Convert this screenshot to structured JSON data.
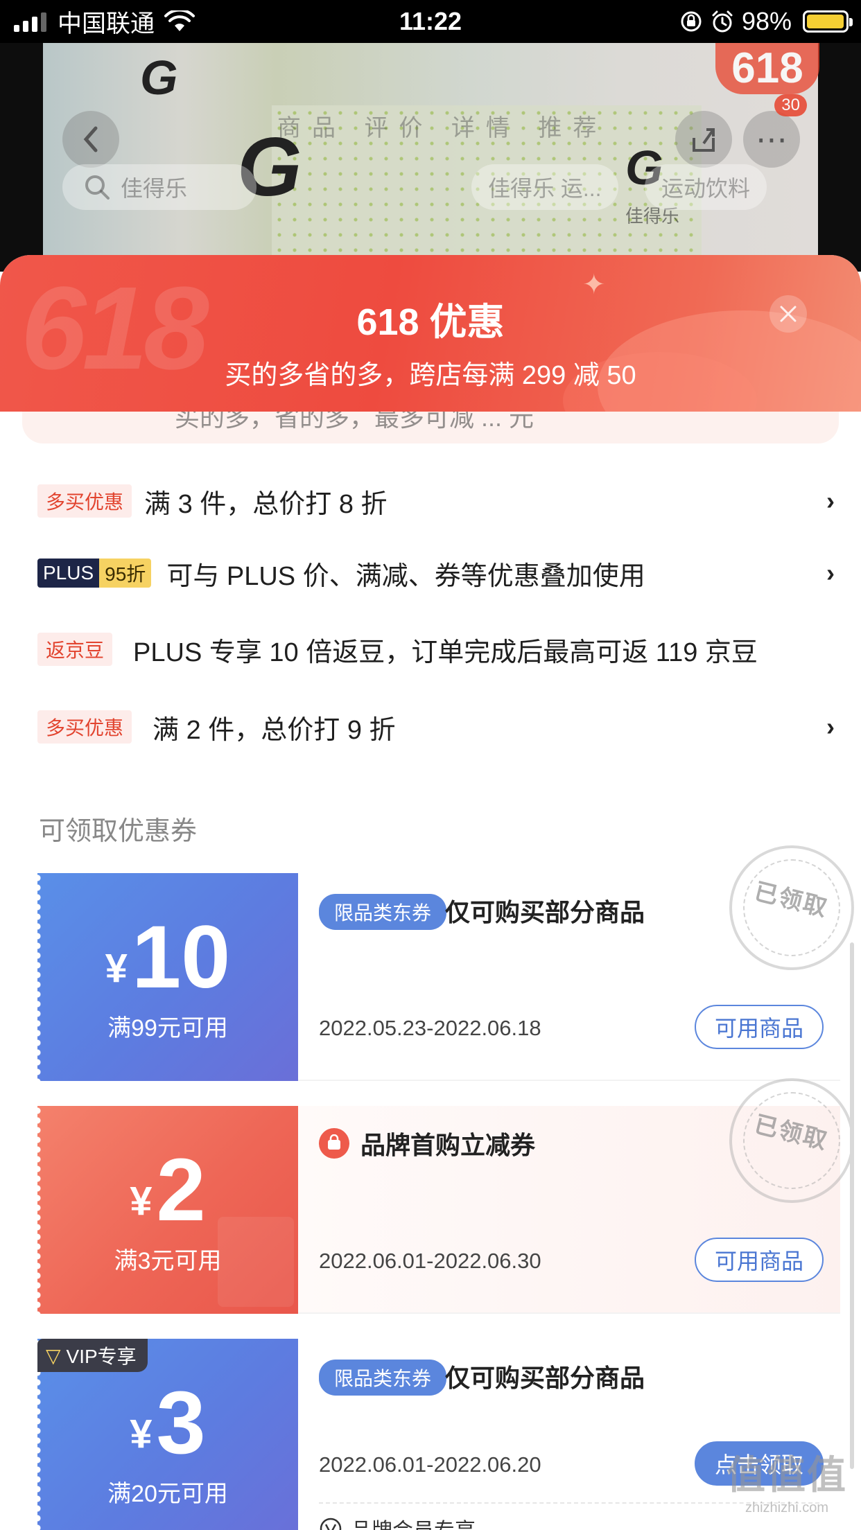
{
  "status_bar": {
    "carrier": "中国联通",
    "time": "11:22",
    "battery_percent": "98%",
    "battery_level": 0.98
  },
  "background_page": {
    "badge": "618",
    "tabs": "商品 评价 详情 推荐",
    "search_placeholder": "佳得乐",
    "chip_1": "佳得乐 运...",
    "chip_2": "运动饮料",
    "cart_count": "30",
    "product_brand": "佳得乐"
  },
  "sheet": {
    "bg_number": "618",
    "title": "618 优惠",
    "subtitle": "买的多省的多，跨店每满 299 减 50",
    "ghost_text": "买的多，省的多，最多可减 ... 元"
  },
  "promos": [
    {
      "tag": "多买优惠",
      "text": "满 3 件，总价打 8 折",
      "arrow": "›"
    },
    {
      "tag_plus": "PLUS",
      "tag_discount": "95折",
      "text": "可与 PLUS 价、满减、券等优惠叠加使用",
      "arrow": "›"
    },
    {
      "tag": "返京豆",
      "text": "PLUS 专享 10 倍返豆，订单完成后最高可返 119 京豆"
    },
    {
      "tag": "多买优惠",
      "text": "满 2 件，总价打 9 折",
      "arrow": "›"
    }
  ],
  "coupon_section_title": "可领取优惠券",
  "coupons": [
    {
      "currency": "¥",
      "amount": "10",
      "condition": "满99元可用",
      "pill": "限品类东券",
      "title": "仅可购买部分商品",
      "date": "2022.05.23-2022.06.18",
      "button": "可用商品",
      "stamp": "已领取"
    },
    {
      "currency": "¥",
      "amount": "2",
      "condition": "满3元可用",
      "title": "品牌首购立减券",
      "date": "2022.06.01-2022.06.30",
      "button": "可用商品",
      "stamp": "已领取"
    },
    {
      "vip_badge": "VIP专享",
      "currency": "¥",
      "amount": "3",
      "condition": "满20元可用",
      "pill": "限品类东券",
      "title": "仅可购买部分商品",
      "date": "2022.06.01-2022.06.20",
      "button": "点击领取",
      "member_note": "品牌会员专享"
    }
  ],
  "watermark": {
    "line1": "值值值",
    "line2": "zhizhizhi.com"
  },
  "colors": {
    "accent_red": "#ee4b3f",
    "coupon_blue": "#5b86dd",
    "coupon_red": "#ee6656",
    "tag_red": "#e2442f",
    "plus_navy": "#1d2547",
    "plus_gold": "#f6d262"
  }
}
